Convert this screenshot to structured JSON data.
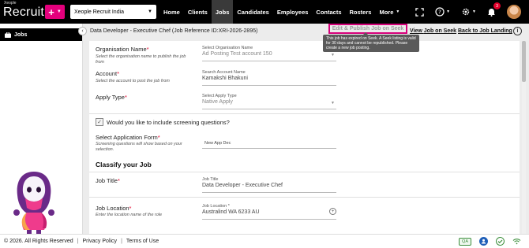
{
  "brand": {
    "small": "Xeople",
    "big": "Recruit"
  },
  "org_select": {
    "value": "Xeople Recruit India"
  },
  "nav": [
    {
      "label": "Home"
    },
    {
      "label": "Clients"
    },
    {
      "label": "Jobs"
    },
    {
      "label": "Candidates"
    },
    {
      "label": "Employees"
    },
    {
      "label": "Contacts"
    },
    {
      "label": "Rosters"
    },
    {
      "label": "More"
    }
  ],
  "notifications": {
    "count": "3"
  },
  "sidebar": {
    "item": "Jobs"
  },
  "header": {
    "title": "Data Developer - Executive Chef (Job Reference ID:XRI-2026-2895)",
    "edit_publish": "Edit & Publish Job on Seek",
    "job_on_seek": "Job on Seek",
    "back_link": "Back to Job Landing",
    "tooltip": "This job has expired on Seek. A Seek listing is valid for 30 days and cannot be republished. Please create a new job posting."
  },
  "form": {
    "org_name": {
      "label": "Organisation Name",
      "hint": "Select the organisation name to publish the job from",
      "field_label": "Select Organisation Name",
      "value": "Ad Posting Test account 150"
    },
    "account": {
      "label": "Account",
      "hint": "Select the account to post the job from",
      "field_label": "Search Account Name",
      "value": "Kamakshi Bhakuni"
    },
    "apply_type": {
      "label": "Apply Type",
      "field_label": "Select Apply Type",
      "value": "Native Apply"
    },
    "screening": {
      "label": "Would you like to include screening questions?"
    },
    "app_form": {
      "label": "Select Application Form",
      "hint": "Screening questions will show based on your selection.",
      "value": "New App Dec"
    },
    "classify": {
      "title": "Classify your Job"
    },
    "job_title": {
      "label": "Job Title",
      "field_label": "Job Title",
      "value": "Data Developer - Executive Chef"
    },
    "job_location": {
      "label": "Job Location",
      "hint": "Enter the location name of the role",
      "field_label": "Job Location *",
      "value": "Australind WA 6233 AU"
    }
  },
  "footer": {
    "copyright": "© 2026. All Rights Reserved",
    "privacy": "Privacy Policy",
    "terms": "Terms of Use",
    "qa": "QA"
  },
  "colors": {
    "accent": "#e4007c",
    "topbar": "#000000",
    "required": "#e4002b"
  }
}
